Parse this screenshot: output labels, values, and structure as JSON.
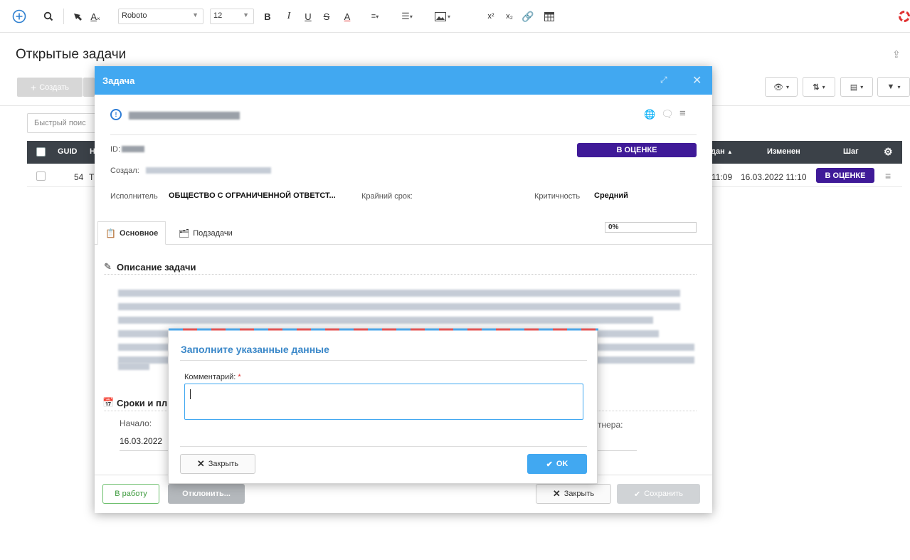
{
  "toolbar": {
    "font_name": "Roboto",
    "font_size": "12",
    "bold": "B",
    "italic": "I",
    "underline": "U",
    "strike": "S",
    "font_color": "A",
    "superscript": "x²",
    "subscript": "x₂"
  },
  "page": {
    "title": "Открытые задачи",
    "create_label": "Создать"
  },
  "grid": {
    "search_placeholder": "Быстрый поис",
    "columns": {
      "guid": "GUID",
      "col2_partial": "Н",
      "created_partial": "дан",
      "modified": "Изменен",
      "step": "Шаг"
    },
    "row": {
      "guid": "54",
      "col2_partial": "Т",
      "created_partial": "11:09",
      "modified": "16.03.2022 11:10",
      "step": "В ОЦЕНКЕ"
    }
  },
  "task_modal": {
    "title": "Задача",
    "id_label": "ID:",
    "status": "В ОЦЕНКЕ",
    "created_by_label": "Создал:",
    "executor_label": "Исполнитель",
    "executor_value": "ОБЩЕСТВО С ОГРАНИЧЕННОЙ ОТВЕТСТ...",
    "deadline_label": "Крайний срок:",
    "criticality_label": "Критичность",
    "criticality_value": "Средний",
    "progress": "0%",
    "progress_fraction": 0,
    "tabs": [
      "Основное",
      "Подзадачи"
    ],
    "description_title": "Описание задачи",
    "dates_title": "Сроки и пл",
    "start_label": "Начало:",
    "start_value": "16.03.2022",
    "partner_label_partial": "тнера:",
    "buttons": {
      "to_work": "В работу",
      "reject": "Отклонить...",
      "close": "Закрыть",
      "save": "Сохранить"
    }
  },
  "prompt_dialog": {
    "title": "Заполните указанные данные",
    "comment_label": "Комментарий:",
    "required_mark": "*",
    "close_label": "Закрыть",
    "ok_label": "OK"
  },
  "colors": {
    "accent": "#41a8f1",
    "badge": "#3f1a98",
    "ok_button": "#41a8f1",
    "required": "#e03030",
    "grid_header": "#3b4148"
  }
}
